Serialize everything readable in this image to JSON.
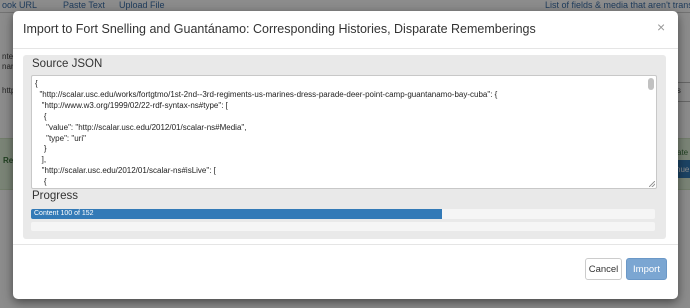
{
  "background": {
    "tabs": [
      "ook URL",
      "Paste Text",
      "Upload File"
    ],
    "link_right": "List of fields & media that aren't transferre",
    "fragments": [
      "nter",
      "nari",
      "http",
      "ngs",
      "Re",
      "ate",
      "nue"
    ]
  },
  "modal": {
    "title": "Import to Fort Snelling and Guantánamo: Corresponding Histories, Disparate Rememberings",
    "close_glyph": "×",
    "source_label": "Source JSON",
    "json_lines": [
      "{",
      "  \"http://scalar.usc.edu/works/fortgtmo/1st-2nd--3rd-regiments-us-marines-dress-parade-deer-point-camp-guantanamo-bay-cuba\": {",
      "   \"http://www.w3.org/1999/02/22-rdf-syntax-ns#type\": [",
      "    {",
      "     \"value\": \"http://scalar.usc.edu/2012/01/scalar-ns#Media\",",
      "     \"type\": \"uri\"",
      "    }",
      "   ],",
      "   \"http://scalar.usc.edu/2012/01/scalar-ns#isLive\": [",
      "    {"
    ],
    "progress_label": "Progress",
    "progress_text": "Content 100 of 152",
    "progress_fraction": 0.658,
    "cancel_label": "Cancel",
    "import_label": "Import"
  }
}
